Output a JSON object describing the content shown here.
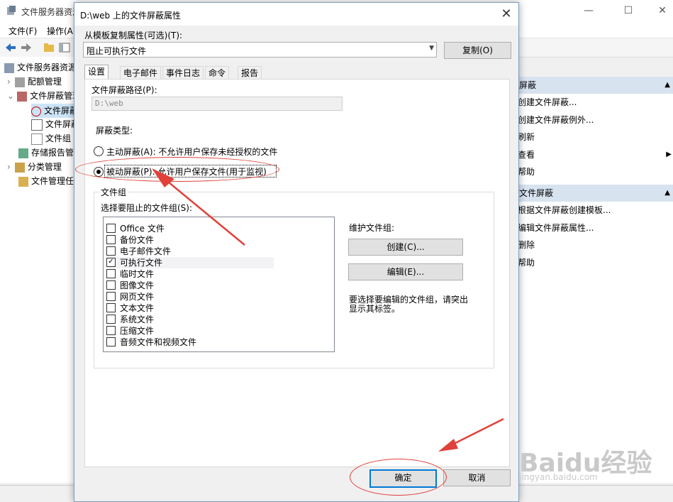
{
  "main_window": {
    "title": "文件服务器资源",
    "menu": [
      "文件(F)",
      "操作(A)"
    ],
    "tree": [
      {
        "label": "文件服务器资源",
        "indent": 0
      },
      {
        "label": "配额管理",
        "indent": 1
      },
      {
        "label": "文件屏蔽管理",
        "indent": 1
      },
      {
        "label": "文件屏蔽",
        "indent": 2
      },
      {
        "label": "文件屏蔽",
        "indent": 2
      },
      {
        "label": "文件组",
        "indent": 2
      },
      {
        "label": "存储报告管",
        "indent": 1
      },
      {
        "label": "分类管理",
        "indent": 1
      },
      {
        "label": "文件管理任",
        "indent": 1
      }
    ],
    "actions": {
      "section1_title": "屏蔽",
      "section1_items": [
        "创建文件屏蔽...",
        "创建文件屏蔽例外...",
        "刷新",
        "查看",
        "帮助"
      ],
      "section2_title": "文件屏蔽",
      "section2_items": [
        "根据文件屏蔽创建模板...",
        "编辑文件屏蔽属性...",
        "删除",
        "帮助"
      ]
    }
  },
  "dialog": {
    "title": "D:\\web 上的文件屏蔽属性",
    "close_glyph": "✕",
    "template_label": "从模板复制属性(可选)(T):",
    "template_value": "阻止可执行文件",
    "copy_button": "复制(O)",
    "tabs": [
      "设置",
      "电子邮件",
      "事件日志",
      "命令",
      "报告"
    ],
    "active_tab": 0,
    "path_label": "文件屏蔽路径(P):",
    "path_value": "D:\\web",
    "screen_type_label": "屏蔽类型:",
    "radio_active": "主动屏蔽(A): 不允许用户保存未经授权的文件",
    "radio_passive": "被动屏蔽(P): 允许用户保存文件(用于监视)",
    "selected_radio": "passive",
    "file_groups_title": "文件组",
    "select_groups_label": "选择要阻止的文件组(S):",
    "file_groups": [
      {
        "label": "Office 文件",
        "checked": false
      },
      {
        "label": "备份文件",
        "checked": false
      },
      {
        "label": "电子邮件文件",
        "checked": false
      },
      {
        "label": "可执行文件",
        "checked": true
      },
      {
        "label": "临时文件",
        "checked": false
      },
      {
        "label": "图像文件",
        "checked": false
      },
      {
        "label": "网页文件",
        "checked": false
      },
      {
        "label": "文本文件",
        "checked": false
      },
      {
        "label": "系统文件",
        "checked": false
      },
      {
        "label": "压缩文件",
        "checked": false
      },
      {
        "label": "音频文件和视频文件",
        "checked": false
      }
    ],
    "maintain_label": "维护文件组:",
    "create_button": "创建(C)...",
    "edit_button": "编辑(E)...",
    "hint_text": "要选择要编辑的文件组，请突出显示其标签。",
    "ok_button": "确定",
    "cancel_button": "取消"
  },
  "colors": {
    "accent": "#0078d7",
    "annotation": "#e0413a",
    "action_header": "#d8e3f0"
  },
  "watermark": {
    "brand": "Baidu经验",
    "url": "jingyan.baidu.com"
  }
}
